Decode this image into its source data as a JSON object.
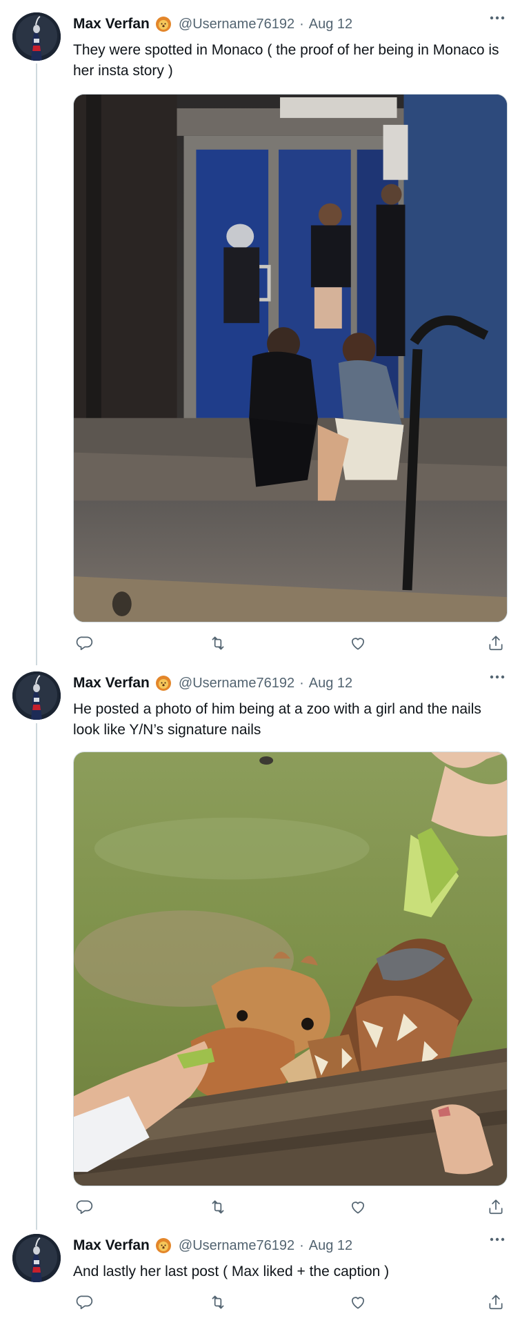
{
  "colors": {
    "text": "#0f1419",
    "muted": "#536471",
    "line": "#cfd9de",
    "icon": "#536471"
  },
  "tweets": [
    {
      "author_name": "Max Verfan",
      "badge_icon": "lion-emoji-icon",
      "handle": "@Username76192",
      "separator": "·",
      "date": "Aug 12",
      "text": "They were spotted in Monaco ( the proof of her being in Monaco is her insta story )",
      "media": "photo-street-night"
    },
    {
      "author_name": "Max Verfan",
      "badge_icon": "lion-emoji-icon",
      "handle": "@Username76192",
      "separator": "·",
      "date": "Aug 12",
      "text": "He posted a photo of him being at a zoo with a girl and the nails look like Y/N’s signature nails",
      "media": "photo-giraffes-zoo"
    },
    {
      "author_name": "Max Verfan",
      "badge_icon": "lion-emoji-icon",
      "handle": "@Username76192",
      "separator": "·",
      "date": "Aug 12",
      "text": "And lastly her last post ( Max liked + the caption )",
      "media": null
    }
  ],
  "action_icons": [
    "reply-icon",
    "retweet-icon",
    "like-icon",
    "share-icon"
  ]
}
